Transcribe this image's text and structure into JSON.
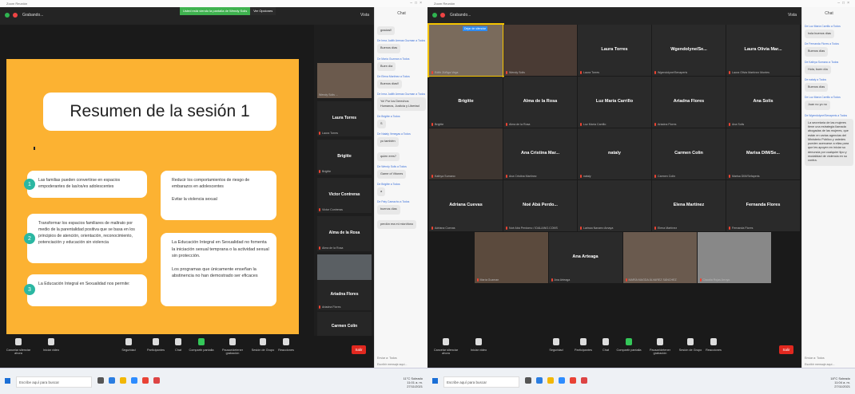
{
  "left": {
    "title": "Zoom Reunión",
    "topbar": {
      "label": "Grabando...",
      "vista": "Vista"
    },
    "banner": {
      "sharing": "Usted está viendo la pantalla de Wendy Solis",
      "options": "Ver Opciones"
    },
    "slide": {
      "title": "Resumen de la sesión 1",
      "card1": "Las familias pueden convertirse en espacios empoderantes de las/os/es adolescentes",
      "card2": "Transformar los espacios familiares de maltrato por medio de la parentalidad positiva que se basa en los principios de atención, orientación, reconocimiento, potenciación y educación sin violencia",
      "card3": "La Educación Integral en Sexualidad nos permite:",
      "card4a": "Reducir los comportamientos de riesgo de embarazos en adolescentes",
      "card4b": "Evitar la violencia sexual",
      "card5a": "La Educación Integral en Sexualidad no fomenta la iniciación sexual temprana o la actividad sexual sin protección.",
      "card5b": "Los programas que únicamente enseñan la abstinencia no han demostrado ser eficaces",
      "nums": [
        "1",
        "2",
        "3"
      ]
    },
    "side": [
      {
        "name": "",
        "sub": "Wendy Solis ..."
      },
      {
        "name": "Laura Torres",
        "sub": "Laura Torres"
      },
      {
        "name": "Brigitte",
        "sub": "Brigitte"
      },
      {
        "name": "Victor Contreras",
        "sub": "Victor Contreras"
      },
      {
        "name": "Alma de la Rosa",
        "sub": "Alma de la Rosa"
      },
      {
        "name": "",
        "sub": "MARÍA ALVAREZ ..."
      },
      {
        "name": "Ariadna Flores",
        "sub": "Ariadna Flores"
      },
      {
        "name": "Carmen Colin",
        "sub": "Carmen Colin"
      }
    ],
    "toolbar": [
      "Cancelar silenciar ahora",
      "Iniciar video",
      "Seguridad",
      "Participantes",
      "Chat",
      "Compartir pantalla",
      "Pausar/detener grabación",
      "Sesión de Grupo",
      "Reacciones"
    ],
    "leave": "Salir",
    "chat": {
      "header": "Chat",
      "messages": [
        {
          "who": "",
          "text": "gracias!!"
        },
        {
          "who": "De Irma Judith Arenas Guzman a Todos",
          "text": "Buenos días"
        },
        {
          "who": "De María Guzman a Todos",
          "text": "Buen día"
        },
        {
          "who": "De Elena Martínez a Todos",
          "text": "Buenos días!!"
        },
        {
          "who": "De Irma Judith Arenas Guzman a Todos",
          "text": "Yo! Por los Derechos Humanos, Justicia y Libertad"
        },
        {
          "who": "De Brigitte a Todos",
          "text": "S"
        },
        {
          "who": "De Nataly Venegas a Todos",
          "text": "yo también"
        },
        {
          "who": "",
          "text": "quien eres?"
        },
        {
          "who": "De Wendy Solis a Todos",
          "text": "Game of Vitones"
        },
        {
          "who": "De Brigitte a Todos",
          "text": "a"
        },
        {
          "who": "De Paty Camacho a Todos",
          "text": "buenos días"
        },
        {
          "who": "",
          "text": "perdón era mi micrófono"
        }
      ],
      "to": "Enviar a: Todos",
      "input": "Escribir mensaje aquí..."
    },
    "taskbar": {
      "search": "Escribe aquí para buscar",
      "tray": "11°C Soleado",
      "time": "11:01 a. m.",
      "date": "27/11/2021"
    }
  },
  "right": {
    "title": "Zoom Reunión",
    "topbar": {
      "label": "Grabando...",
      "vista": "Vista"
    },
    "unmute": "Dejar de silenciar",
    "grid": [
      {
        "name": "",
        "sub": "Edith Zúñiga Vega"
      },
      {
        "name": "",
        "sub": "Wendy Solis"
      },
      {
        "name": "Laura Torres",
        "sub": "Laura Torres"
      },
      {
        "name": "Wgendolyne/Se...",
        "sub": "Wgendolyne/Senaperis"
      },
      {
        "name": "Laura Olivia Mar...",
        "sub": "Laura Olivia Martínez Montes"
      },
      {
        "name": "Brigitte",
        "sub": "Brigitte"
      },
      {
        "name": "Alma de la Rosa",
        "sub": "Alma de la Rosa"
      },
      {
        "name": "Luz María Carrillo",
        "sub": "Luz María Carrillo"
      },
      {
        "name": "Ariadna Flores",
        "sub": "Ariadna Flores"
      },
      {
        "name": "Ana Solis",
        "sub": "Ana Solis"
      },
      {
        "name": "",
        "sub": "Kathya Sumano"
      },
      {
        "name": "Ana Cristina Mar...",
        "sub": "Ana Cristina Martínez"
      },
      {
        "name": "nataly",
        "sub": "nataly"
      },
      {
        "name": "Carmen Colin",
        "sub": "Carmen Colin"
      },
      {
        "name": "Marisa DIM/Se...",
        "sub": "Marisa DIM/Sefaperis"
      },
      {
        "name": "Adriana Cuevas",
        "sub": "Adriana Cuevas"
      },
      {
        "name": "Noé Abá Perdo...",
        "sub": "Noé Abá Perdomo / IDALIANO.COMS"
      },
      {
        "name": "",
        "sub": "Larissa Navarro Amaya"
      },
      {
        "name": "Elena Martínez",
        "sub": "Elena Martínez"
      },
      {
        "name": "Fernanda Flores",
        "sub": "Fernanda Flores"
      },
      {
        "name": "",
        "sub": "María Guzman"
      },
      {
        "name": "Ana Arteaga",
        "sub": "Ana Arteaga"
      },
      {
        "name": "",
        "sub": "MARÍA MAGDA ÁLVAREZ SÁNCHEZ"
      },
      {
        "name": "",
        "sub": "Claudia Rojas Arroyo"
      }
    ],
    "chat": {
      "header": "Chat",
      "messages": [
        {
          "who": "De Luz María Carrillo a Todos",
          "text": "hola buenos días"
        },
        {
          "who": "De Fernanda Flores a Todos",
          "text": "Buenos días"
        },
        {
          "who": "De Kathya Sumano a Todos",
          "text": "Hola, buen día"
        },
        {
          "who": "De nataly a Todos",
          "text": "Buenos días"
        },
        {
          "who": "De Luz María Carrillo a Todos",
          "text": "Juan no yo no"
        },
        {
          "who": "De Wgendolyne/Senaperis a Todos",
          "text": "La secretaría de las mujeres tiene una estrategia llamada abogadas de las mujeres, que están en varias agencias del Ministerio Público y ustedes pueden acercarse a ellas para que les apoyen en iniciar su denuncia por cualquier tipo y modalidad de violencia en su contra."
        }
      ],
      "to": "Enviar a: Todos",
      "input": "Escribir mensaje aquí..."
    },
    "taskbar": {
      "search": "Escribe aquí para buscar",
      "tray": "18°C Soleado",
      "time": "11:04 a. m.",
      "date": "27/11/2021"
    }
  },
  "colors": {
    "slide_bg": "#fcb232",
    "accent_teal": "#2bb7a2",
    "leave_red": "#e1281f"
  }
}
